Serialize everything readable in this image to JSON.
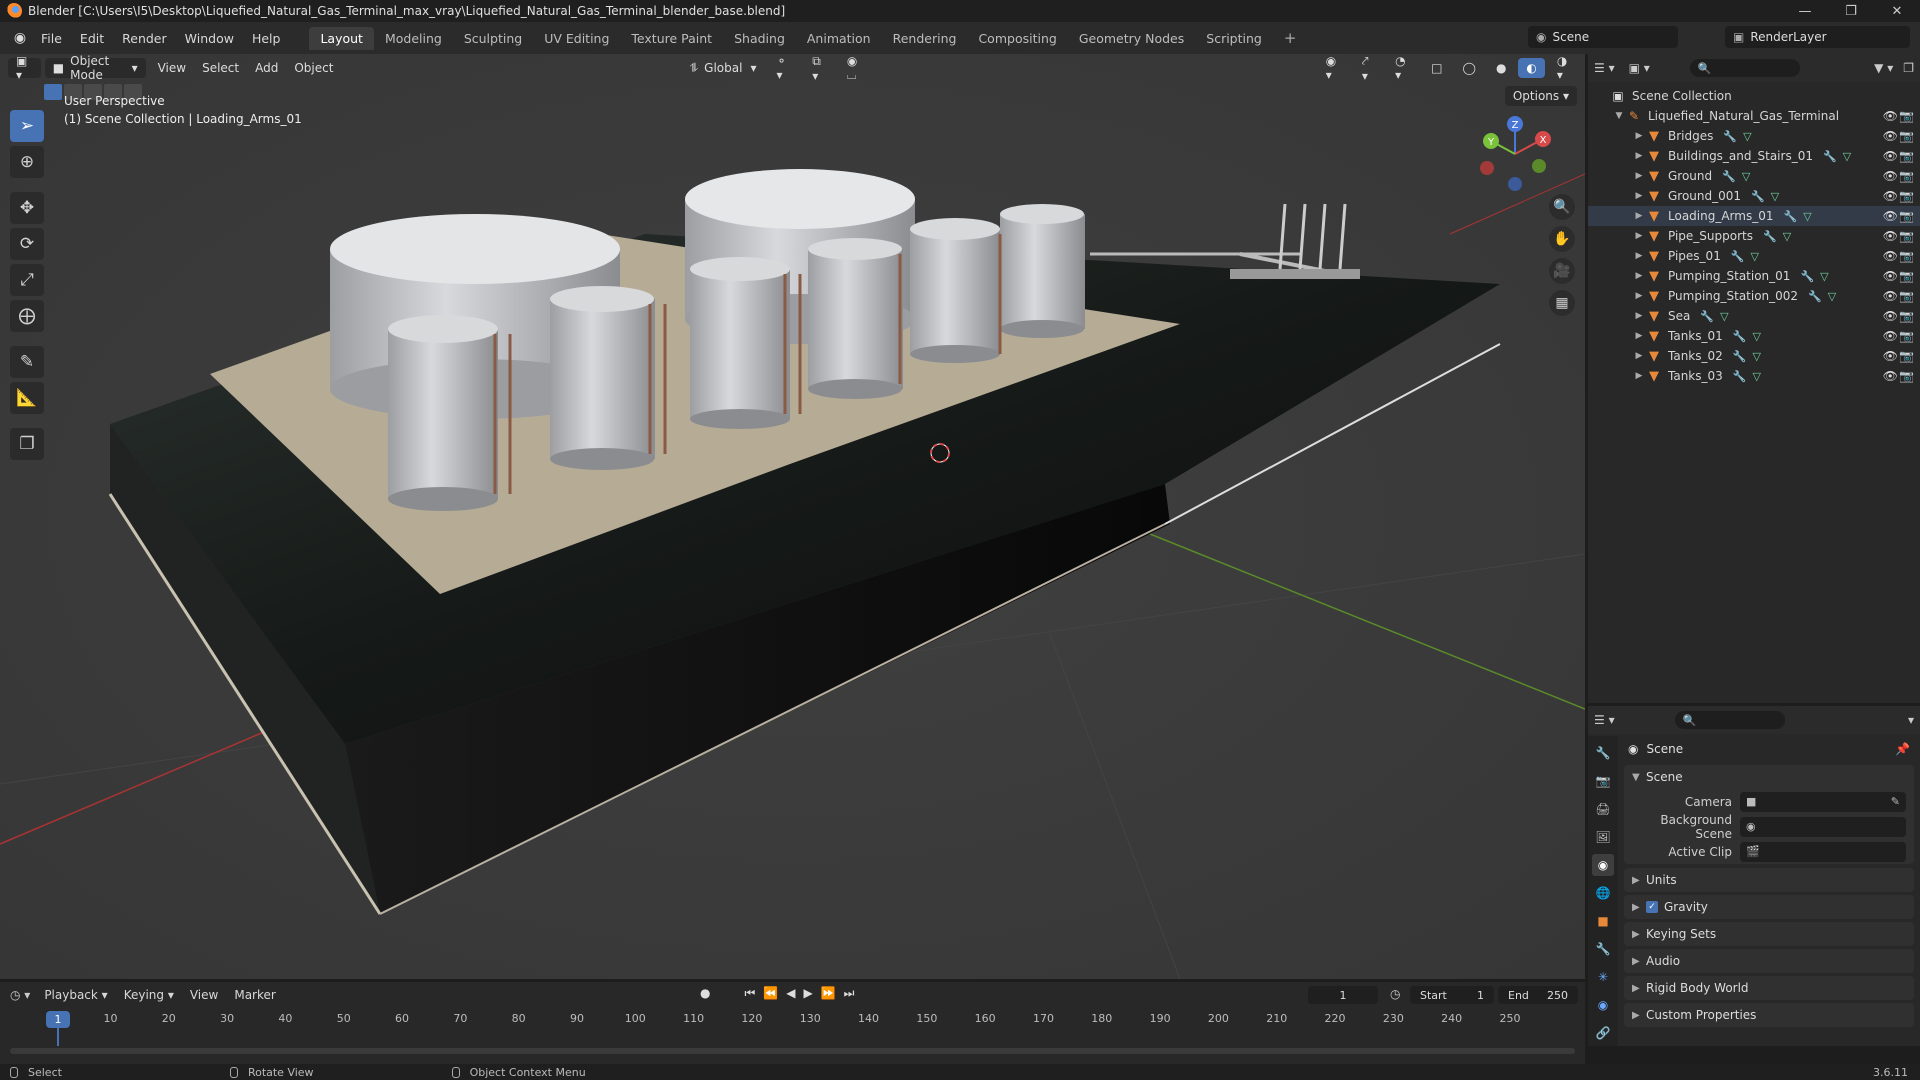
{
  "window": {
    "title": "Blender [C:\\Users\\I5\\Desktop\\Liquefied_Natural_Gas_Terminal_max_vray\\Liquefied_Natural_Gas_Terminal_blender_base.blend]"
  },
  "menubar": {
    "items": [
      "File",
      "Edit",
      "Render",
      "Window",
      "Help"
    ],
    "workspaces": [
      "Layout",
      "Modeling",
      "Sculpting",
      "UV Editing",
      "Texture Paint",
      "Shading",
      "Animation",
      "Rendering",
      "Compositing",
      "Geometry Nodes",
      "Scripting"
    ],
    "active_workspace": "Layout",
    "scene": "Scene",
    "view_layer": "RenderLayer"
  },
  "viewport": {
    "mode": "Object Mode",
    "menus": [
      "View",
      "Select",
      "Add",
      "Object"
    ],
    "orientation": "Global",
    "options_label": "Options",
    "info_line1": "User Perspective",
    "info_line2": "(1) Scene Collection | Loading_Arms_01"
  },
  "outliner": {
    "root": "Scene Collection",
    "collection": "Liquefied_Natural_Gas_Terminal",
    "objects": [
      "Bridges",
      "Buildings_and_Stairs_01",
      "Ground",
      "Ground_001",
      "Loading_Arms_01",
      "Pipe_Supports",
      "Pipes_01",
      "Pumping_Station_01",
      "Pumping_Station_002",
      "Sea",
      "Tanks_01",
      "Tanks_02",
      "Tanks_03"
    ]
  },
  "properties": {
    "context": "Scene",
    "panel_scene": "Scene",
    "camera_label": "Camera",
    "background_scene_label": "Background Scene",
    "active_clip_label": "Active Clip",
    "panels": [
      "Units",
      "Gravity",
      "Keying Sets",
      "Audio",
      "Rigid Body World",
      "Custom Properties"
    ]
  },
  "timeline": {
    "menus": [
      "Playback",
      "Keying",
      "View",
      "Marker"
    ],
    "current_frame": "1",
    "start_label": "Start",
    "start": "1",
    "end_label": "End",
    "end": "250",
    "ticks": [
      "10",
      "20",
      "30",
      "40",
      "50",
      "60",
      "70",
      "80",
      "90",
      "100",
      "110",
      "120",
      "130",
      "140",
      "150",
      "160",
      "170",
      "180",
      "190",
      "200",
      "210",
      "220",
      "230",
      "240",
      "250"
    ]
  },
  "statusbar": {
    "select": "Select",
    "rotate": "Rotate View",
    "context_menu": "Object Context Menu",
    "version": "3.6.11"
  }
}
